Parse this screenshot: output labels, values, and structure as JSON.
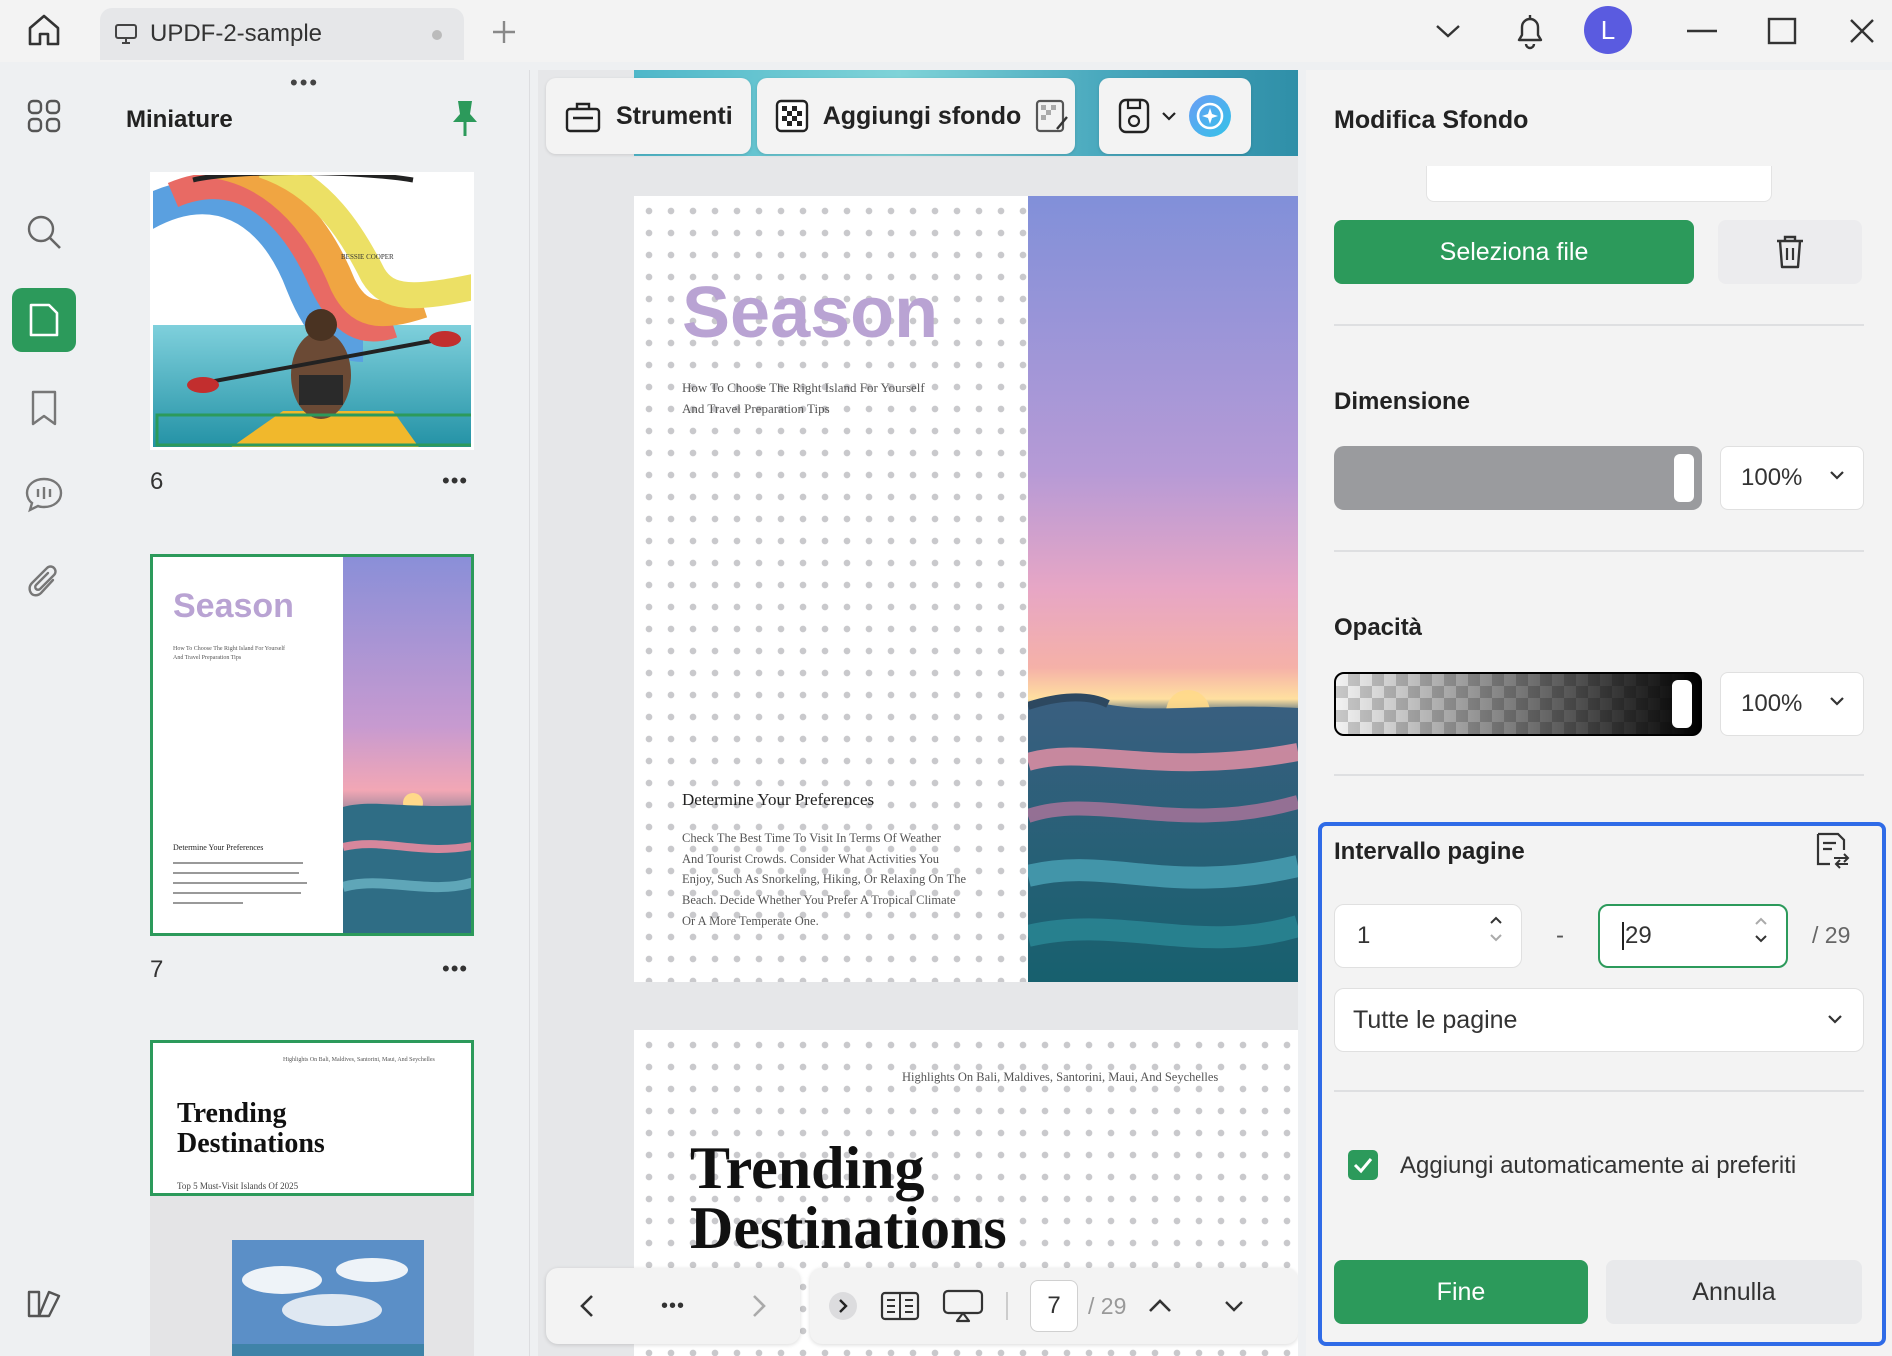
{
  "window": {
    "tab_title": "UPDF-2-sample",
    "avatar_letter": "L"
  },
  "thumbnails": {
    "panel_title": "Miniature",
    "pages": [
      {
        "number": "6",
        "author": "BESSIE COOPER"
      },
      {
        "number": "7",
        "title": "Season",
        "subtitle": "How To Choose The Right Island For Yourself And Travel Preparation Tips",
        "heading": "Determine Your Preferences"
      },
      {
        "title": "Trending Destinations",
        "header": "Highlights On Bali, Maldives, Santorini, Maui, And Seychelles",
        "subtitle": "Top 5 Must-Visit Islands Of 2025"
      }
    ]
  },
  "toolbar": {
    "tools_label": "Strumenti",
    "add_background_label": "Aggiungi sfondo"
  },
  "document": {
    "page7": {
      "title": "Season",
      "subtitle_line1": "How To Choose The Right Island For Yourself",
      "subtitle_line2": "And Travel Preparation Tips",
      "heading": "Determine Your Preferences",
      "body_lines": [
        "Check The Best Time To Visit In Terms Of Weather",
        "And Tourist Crowds. Consider What Activities You",
        "Enjoy, Such As Snorkeling, Hiking, Or Relaxing On The",
        "Beach. Decide Whether You Prefer A Tropical Climate",
        "Or A More Temperate One."
      ]
    },
    "page8": {
      "header": "Highlights On Bali, Maldives, Santorini, Maui, And Seychelles",
      "title_line1": "Trending",
      "title_line2": "Destinations"
    }
  },
  "bottom_nav": {
    "current_page": "7",
    "total_pages": "/ 29"
  },
  "right_panel": {
    "title": "Modifica Sfondo",
    "select_file_label": "Seleziona file",
    "size": {
      "label": "Dimensione",
      "value": "100%",
      "level": 1.0
    },
    "opacity": {
      "label": "Opacità",
      "value": "100%",
      "level": 1.0
    },
    "page_range": {
      "label": "Intervallo pagine",
      "from": "1",
      "separator": "-",
      "to": "29",
      "total": "/ 29",
      "scope": "Tutte le pagine"
    },
    "auto_favorite_label": "Aggiungi automaticamente ai preferiti",
    "auto_favorite_checked": true,
    "done_label": "Fine",
    "cancel_label": "Annulla"
  },
  "colors": {
    "accent_green": "#2c9a5b",
    "focus_blue": "#2f6be7",
    "season_purple": "#b9a3d3",
    "avatar": "#5a5be0"
  }
}
